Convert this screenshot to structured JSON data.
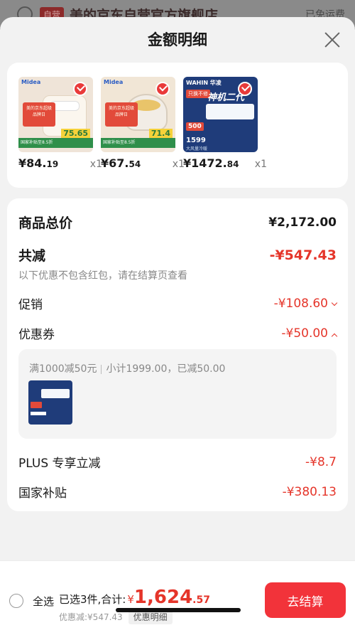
{
  "underlay": {
    "tag": "自营",
    "store": "美的京东自营官方旗舰店",
    "shipping": "已免运费"
  },
  "sheet": {
    "title": "金额明细"
  },
  "products": [
    {
      "brand": "Midea",
      "badge": "美的京东超级品牌日",
      "band": "国家补贴至8.5折",
      "tag_price": "75.65",
      "price_int": "¥84.",
      "price_dec": "19",
      "qty": "x1",
      "bg": "#efe4d8"
    },
    {
      "brand": "Midea",
      "badge": "美的京东超级品牌日",
      "band": "国家补贴至8.5折",
      "tag_price": "71.4",
      "price_int": "¥67.",
      "price_dec": "54",
      "qty": "x1",
      "bg": "#f1e6d6"
    },
    {
      "brand": "WAHIN 华凌",
      "badge": "只换不修",
      "band": "大风量冷暖",
      "tag_price": "1599",
      "headline": "神机二代",
      "price_int": "¥1472.",
      "price_dec": "84",
      "qty": "x1",
      "bg": "#1f3c7a"
    }
  ],
  "details": {
    "total_label": "商品总价",
    "total_value": "¥2,172.00",
    "reduce_label": "共减",
    "reduce_value": "-¥547.43",
    "note": "以下优惠不包含红包，请在结算页查看",
    "promo_label": "促销",
    "promo_value": "-¥108.60",
    "coupon_label": "优惠券",
    "coupon_value": "-¥50.00",
    "coupon_desc": "满1000减50元",
    "coupon_subtotal": "小计1999.00，已减50.00",
    "plus_label": "PLUS 专享立减",
    "plus_value": "-¥8.7",
    "subsidy_label": "国家补贴",
    "subsidy_value": "-¥380.13"
  },
  "bottom": {
    "select_all": "全选",
    "summary": "已选3件,合计:",
    "currency": "¥",
    "total_int": "1,624",
    "total_dec": ".57",
    "discount": "优惠减:¥547.43",
    "detail_link": "优惠明细",
    "checkout": "去结算"
  },
  "colors": {
    "accent": "#e5352a",
    "button": "#f2333a"
  }
}
